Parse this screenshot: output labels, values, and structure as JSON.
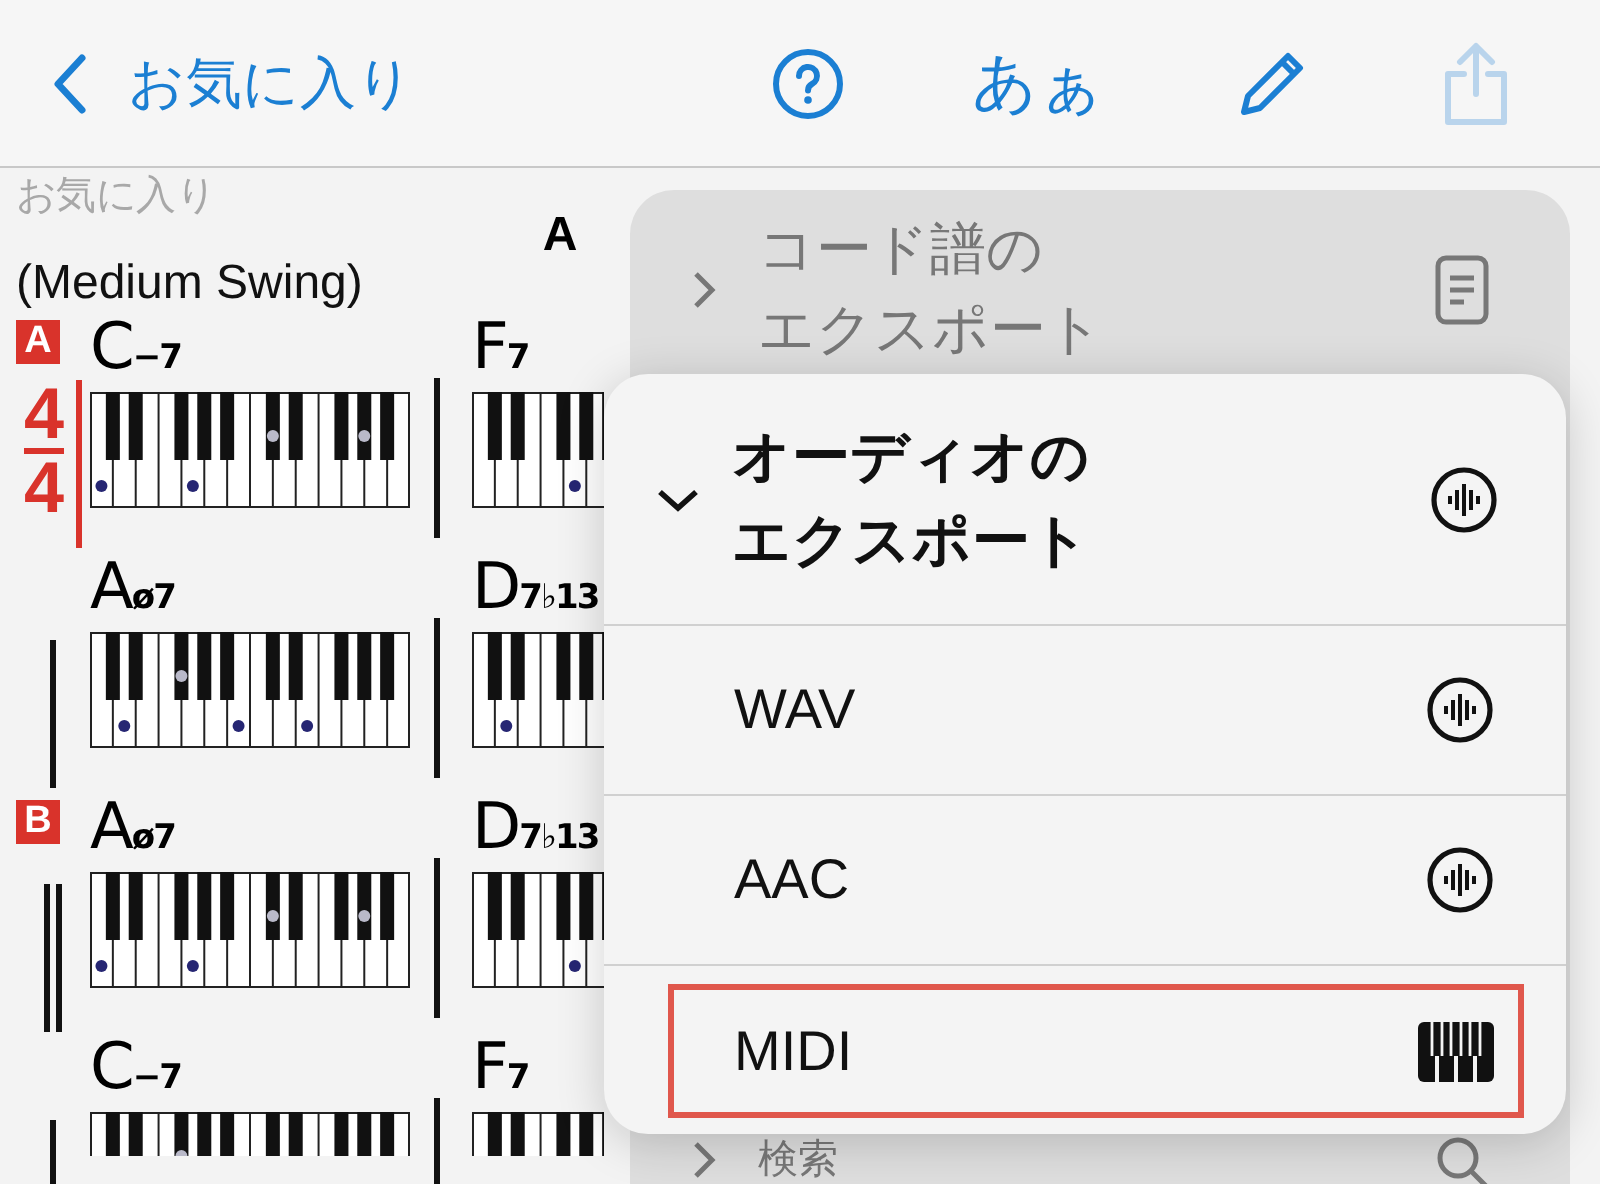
{
  "nav": {
    "back_label": "お気に入り",
    "font_button": "あぁ",
    "share_disabled": true
  },
  "sheet": {
    "folder": "お気に入り",
    "title": "A",
    "style": "(Medium Swing)",
    "rows": [
      {
        "section": "A",
        "time_signature": {
          "numerator": "4",
          "denominator": "4"
        },
        "measures": [
          {
            "root": "C",
            "suffix": "−7"
          },
          {
            "root": "F",
            "suffix": "7"
          }
        ]
      },
      {
        "double_bar": false,
        "measures": [
          {
            "root": "A",
            "suffix": "ø7"
          },
          {
            "root": "D",
            "suffix": "7♭13"
          }
        ]
      },
      {
        "section": "B",
        "double_bar": true,
        "measures": [
          {
            "root": "A",
            "suffix": "ø7"
          },
          {
            "root": "D",
            "suffix": "7♭13"
          }
        ]
      },
      {
        "double_bar": false,
        "measures": [
          {
            "root": "C",
            "suffix": "−7"
          },
          {
            "root": "F",
            "suffix": "7"
          }
        ]
      }
    ]
  },
  "export_menu": {
    "items": [
      {
        "label_lines": [
          "コード譜の",
          "エクスポート"
        ],
        "expanded": false
      },
      {
        "label_lines": [
          "検索"
        ],
        "expanded": false
      }
    ]
  },
  "audio_submenu": {
    "title_lines": [
      "オーディオの",
      "エクスポート"
    ],
    "expanded": true,
    "options": [
      {
        "label": "WAV",
        "highlighted": false
      },
      {
        "label": "AAC",
        "highlighted": false
      },
      {
        "label": "MIDI",
        "highlighted": true
      }
    ]
  }
}
